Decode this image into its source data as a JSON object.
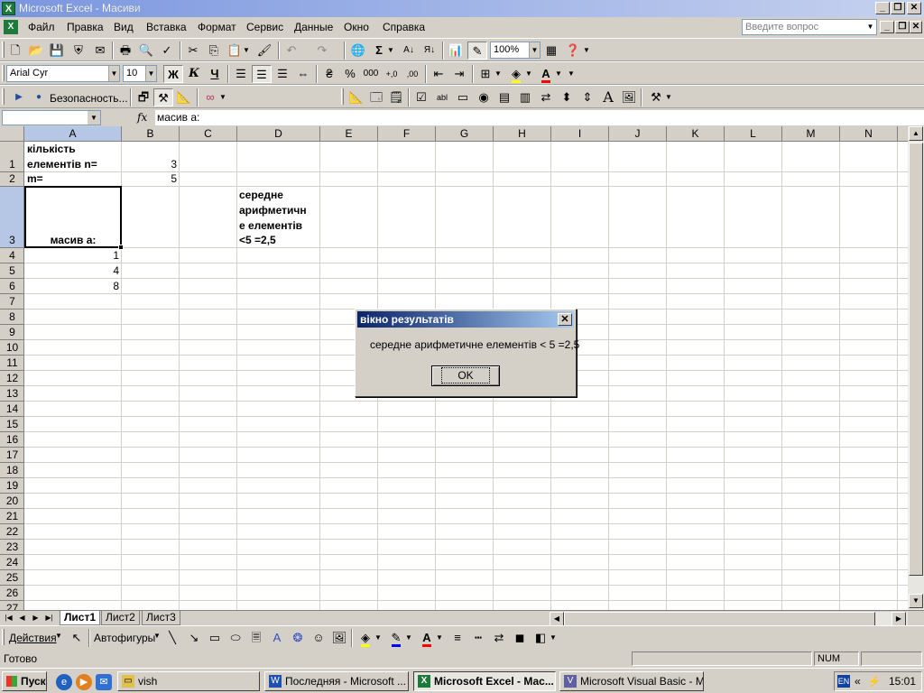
{
  "window": {
    "title": "Microsoft Excel - Масиви"
  },
  "menu": {
    "items": [
      "Файл",
      "Правка",
      "Вид",
      "Вставка",
      "Формат",
      "Сервис",
      "Данные",
      "Окно",
      "Справка"
    ],
    "help_placeholder": "Введите вопрос"
  },
  "toolbar": {
    "zoom": "100%",
    "font_name": "Arial Cyr",
    "font_size": "10",
    "bold_label": "Ж",
    "italic_label": "К",
    "underline_label": "Ч",
    "security_label": "Безопасность..."
  },
  "formula_bar": {
    "name_box": "",
    "fx": "fx",
    "content": "масив а:"
  },
  "grid": {
    "columns": [
      "A",
      "B",
      "C",
      "D",
      "E",
      "F",
      "G",
      "H",
      "I",
      "J",
      "K",
      "L",
      "M",
      "N"
    ],
    "rows": [
      "1",
      "2",
      "3",
      "4",
      "5",
      "6",
      "7",
      "8",
      "9",
      "10",
      "11",
      "12",
      "13",
      "14",
      "15",
      "16",
      "17",
      "18",
      "19",
      "20",
      "21",
      "22",
      "23",
      "24",
      "25",
      "26",
      "27"
    ],
    "cells": {
      "a1_line1": "кількість",
      "a1_line2": "елементів n=",
      "b1": "3",
      "a2": "m=",
      "b2": "5",
      "a3": "масив а:",
      "d3_line1": "середне",
      "d3_line2": "арифметичн",
      "d3_line3": "е елементів",
      "d3_line4": "<5  =2,5",
      "a4": "1",
      "a5": "4",
      "a6": "8"
    }
  },
  "sheets": {
    "tabs": [
      "Лист1",
      "Лист2",
      "Лист3"
    ],
    "active": "Лист1"
  },
  "draw_toolbar": {
    "actions_label": "Действия",
    "autoshapes_label": "Автофигуры"
  },
  "status": {
    "text": "Готово",
    "num": "NUM"
  },
  "taskbar": {
    "start_label": "Пуск",
    "tasks": [
      "vish",
      "Последняя - Microsoft ...",
      "Microsoft Excel - Мас...",
      "Microsoft Visual Basic - M..."
    ],
    "lang": "EN",
    "clock": "15:01"
  },
  "dialog": {
    "title": "вікно результатів",
    "message": "середне арифметичне елементів  <  5  =2,5",
    "ok_label": "OK"
  },
  "colors": {
    "title_gradient_start": "#0a246a",
    "selection_header": "#b6c6e5",
    "excel_green": "#1d7a3a"
  }
}
